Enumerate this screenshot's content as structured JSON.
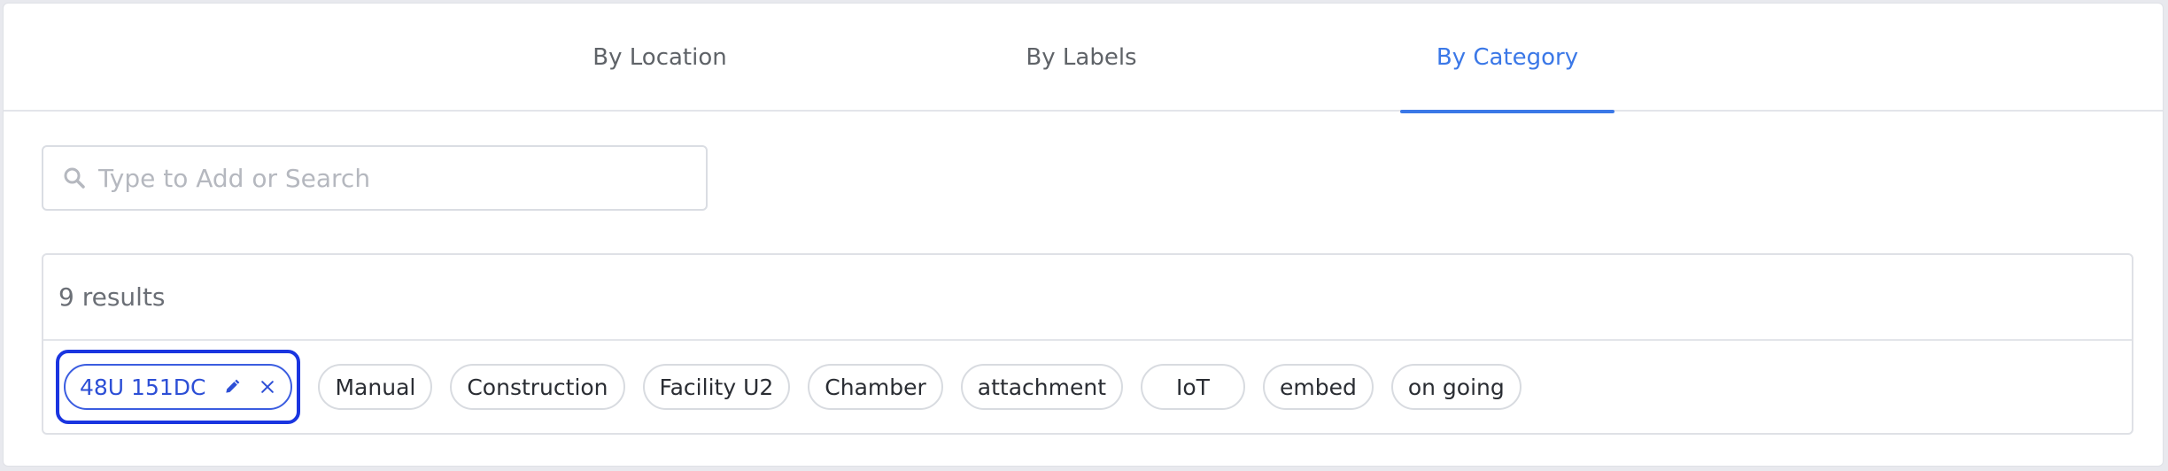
{
  "tabs": [
    {
      "label": "By Location",
      "active": false
    },
    {
      "label": "By Labels",
      "active": false
    },
    {
      "label": "By Category",
      "active": true
    }
  ],
  "search": {
    "placeholder": "Type to Add or Search",
    "icon": "search-icon"
  },
  "results": {
    "count_text": "9 results",
    "selected_chip": {
      "label": "48U 151DC",
      "icons": [
        "edit-icon",
        "close-icon"
      ]
    },
    "chips": [
      "Manual",
      "Construction",
      "Facility U2",
      "Chamber",
      "attachment",
      "IoT",
      "embed",
      "on going"
    ]
  },
  "colors": {
    "accent": "#3b78e7",
    "selected_outline": "#1a35e0",
    "selected_chip_text": "#2d4fd6"
  }
}
